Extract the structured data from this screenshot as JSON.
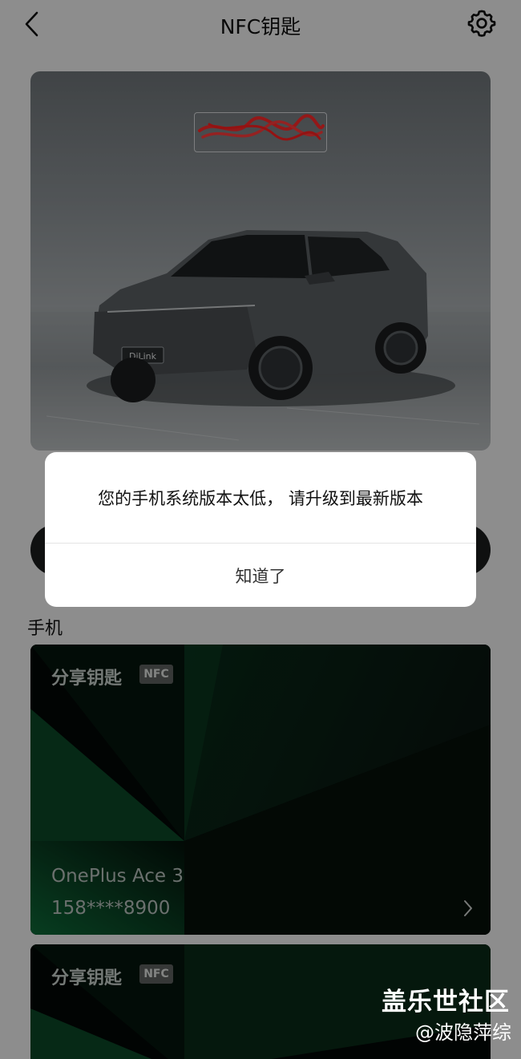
{
  "header": {
    "title": "NFC钥匙",
    "back_icon": "chevron-left-icon",
    "settings_icon": "gear-icon"
  },
  "car_card": {
    "plate_text": "",
    "car_badge": "DiLink"
  },
  "section": {
    "phone_label": "手机"
  },
  "key_cards": [
    {
      "title": "分享钥匙",
      "badge": "NFC",
      "device_name": "OnePlus Ace 3",
      "phone_number": "158****8900",
      "chevron_icon": "chevron-right-icon"
    },
    {
      "title": "分享钥匙",
      "badge": "NFC"
    }
  ],
  "dialog": {
    "message": "您的手机系统版本太低， 请升级到最新版本",
    "confirm_label": "知道了"
  },
  "watermark": {
    "site": "盖乐世社区",
    "user": "@波隐萍综"
  },
  "colors": {
    "overlay": "rgba(0,0,0,0.42)",
    "key_card_bg": "#030706",
    "key_card_green": "#0e5f33",
    "nfc_badge_bg": "#5d615f"
  }
}
